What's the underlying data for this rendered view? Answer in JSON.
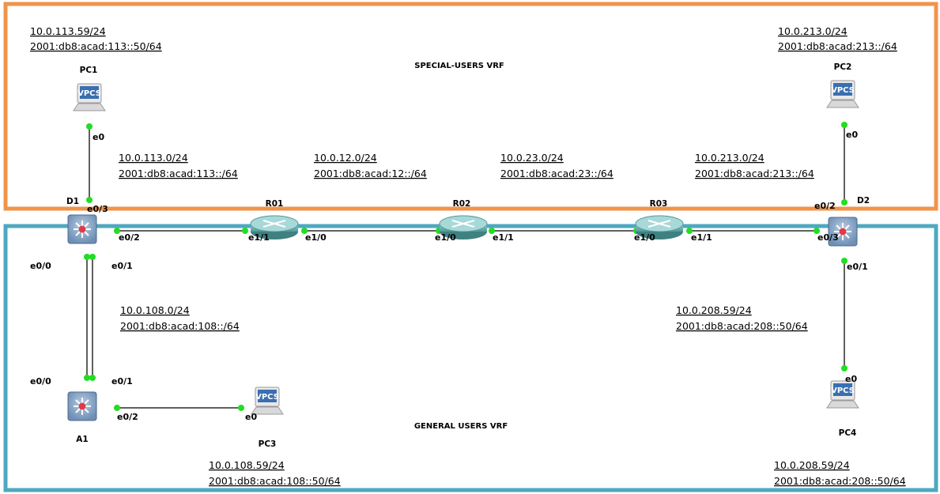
{
  "colors": {
    "special_zone": "#f0944a",
    "general_zone": "#4ea8c0",
    "link": "#2b2b2b",
    "port_dot": "#22dd22",
    "switch_body": "#8ea8c8",
    "router_body": "#6fb0b0",
    "pc_screen": "#3a6fb0"
  },
  "zones": {
    "special": "SPECIAL-USERS VRF",
    "general": "GENERAL USERS VRF"
  },
  "nodes": {
    "pc1": "PC1",
    "pc2": "PC2",
    "pc3": "PC3",
    "pc4": "PC4",
    "d1": "D1",
    "d2": "D2",
    "a1": "A1",
    "r01": "R01",
    "r02": "R02",
    "r03": "R03",
    "vpcs": "VPCS"
  },
  "ports": {
    "pc1_e0": "e0",
    "pc2_e0": "e0",
    "pc3_e0": "e0",
    "pc4_e0": "e0",
    "d1_e0_3": "e0/3",
    "d1_e0_2": "e0/2",
    "d1_e0_0": "e0/0",
    "d1_e0_1": "e0/1",
    "a1_e0_0": "e0/0",
    "a1_e0_1": "e0/1",
    "a1_e0_2": "e0/2",
    "r01_e1_1": "e1/1",
    "r01_e1_0": "e1/0",
    "r02_e1_0": "e1/0",
    "r02_e1_1": "e1/1",
    "r03_e1_0": "e1/0",
    "r03_e1_1": "e1/1",
    "d2_e0_2": "e0/2",
    "d2_e0_3": "e0/3",
    "d2_e0_1": "e0/1"
  },
  "networks": {
    "pc1_v4": "10.0.113.59/24",
    "pc1_v6": "2001:db8:acad:113::50/64",
    "pc2_v4": "10.0.213.0/24",
    "pc2_v6": "2001:db8:acad:213::/64",
    "d1_pc1_v4": "10.0.113.0/24",
    "d1_pc1_v6": "2001:db8:acad:113::/64",
    "r01_r02_v4": "10.0.12.0/24",
    "r01_r02_v6": "2001:db8:acad:12::/64",
    "r02_r03_v4": "10.0.23.0/24",
    "r02_r03_v6": "2001:db8:acad:23::/64",
    "d2_pc2_v4": "10.0.213.0/24",
    "d2_pc2_v6": "2001:db8:acad:213::/64",
    "d1_a1_v4": "10.0.108.0/24",
    "d1_a1_v6": "2001:db8:acad:108::/64",
    "d2_pc4_v4": "10.0.208.59/24",
    "d2_pc4_v6": "2001:db8:acad:208::50/64",
    "pc3_v4": "10.0.108.59/24",
    "pc3_v6": "2001:db8:acad:108::50/64",
    "pc4_v4": "10.0.208.59/24",
    "pc4_v6": "2001:db8:acad:208::50/64"
  }
}
